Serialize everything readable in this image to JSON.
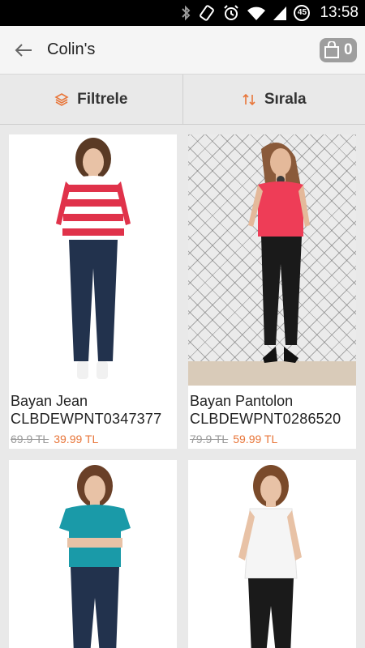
{
  "status": {
    "time": "13:58",
    "battery": "45"
  },
  "header": {
    "title": "Colin's",
    "cart_count": "0"
  },
  "toolbar": {
    "filter_label": "Filtrele",
    "sort_label": "Sırala"
  },
  "products": [
    {
      "name": "Bayan Jean",
      "code": "CLBDEWPNT0347377",
      "old_price": "69.9 TL",
      "new_price": "39.99 TL"
    },
    {
      "name": "Bayan Pantolon",
      "code": "CLBDEWPNT0286520",
      "old_price": "79.9 TL",
      "new_price": "59.99 TL"
    }
  ],
  "colors": {
    "accent": "#e8763a",
    "appbar": "#f5f5f5",
    "background": "#e9e9e9"
  },
  "icons": [
    "back-arrow-icon",
    "cart-icon",
    "layers-icon",
    "sort-arrows-icon"
  ]
}
